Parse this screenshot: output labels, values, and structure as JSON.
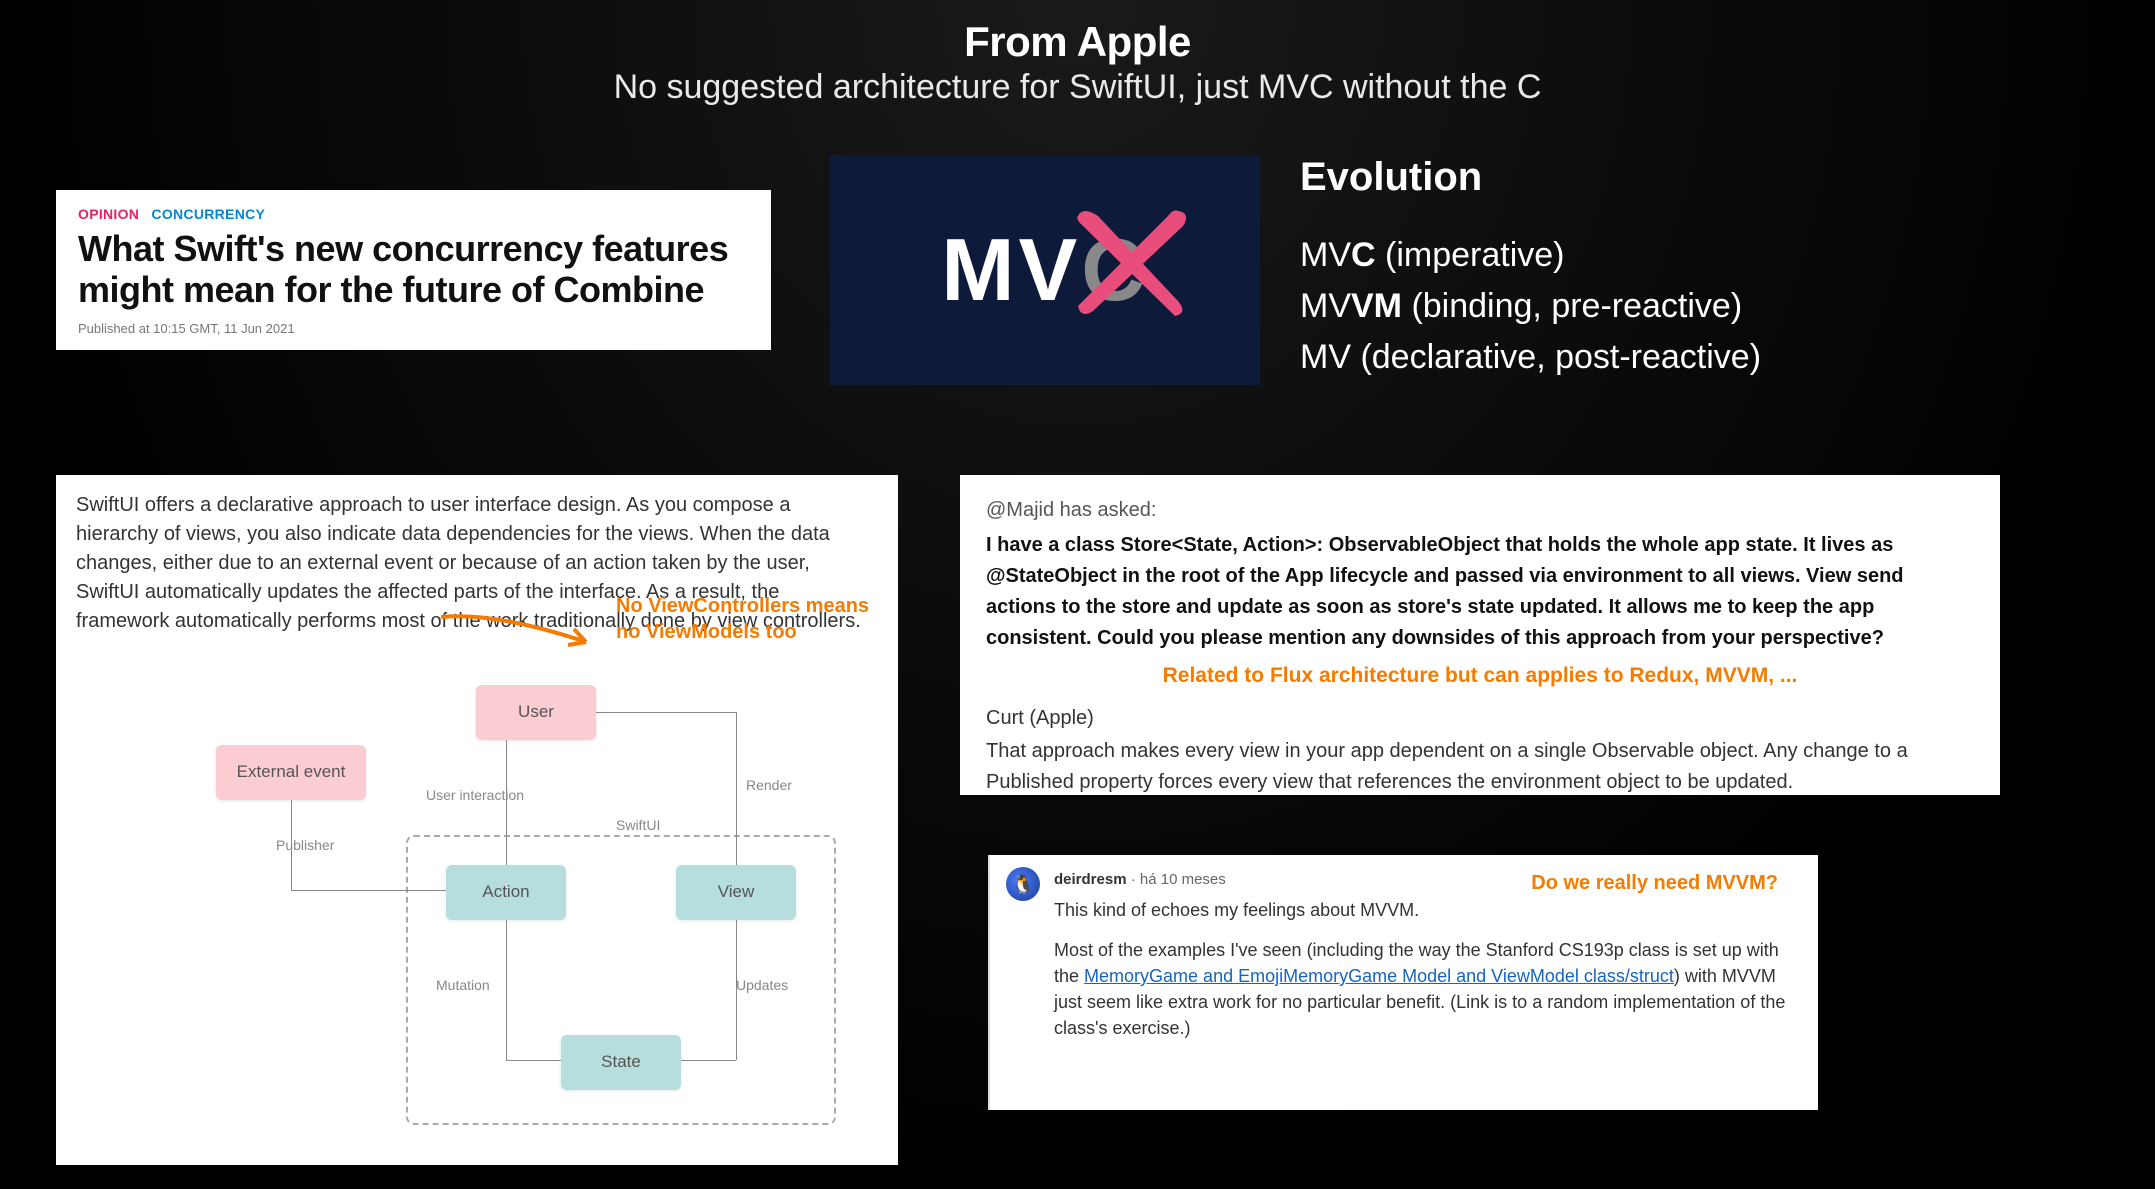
{
  "header": {
    "title": "From Apple",
    "subtitle": "No suggested architecture for SwiftUI, just MVC without the C"
  },
  "article": {
    "tag_opinion": "OPINION",
    "tag_concurrency": "CONCURRENCY",
    "title": "What Swift's new concurrency features might mean for the future of Combine",
    "published": "Published at 10:15 GMT, 11 Jun 2021"
  },
  "mvx": {
    "prefix": "MV",
    "crossed": "C"
  },
  "evolution": {
    "title": "Evolution",
    "line1_prefix": "MV",
    "line1_bold": "C",
    "line1_desc": " (imperative)",
    "line2_prefix": "MV",
    "line2_bold": "VM",
    "line2_desc": " (binding, pre-reactive)",
    "line3_prefix": "MV",
    "line3_bold": "",
    "line3_desc": " (declarative, post-reactive)"
  },
  "swiftui": {
    "para": "SwiftUI offers a declarative approach to user interface design. As you compose a hierarchy of views, you also indicate data dependencies for the views. When the data changes, either due to an external event or because of an action taken by the user, SwiftUI automatically updates the affected parts of the interface. As a result, the framework automatically performs most of the work traditionally done by view controllers.",
    "annotation": "No ViewControllers means no ViewModels too",
    "diagram": {
      "external_event": "External event",
      "user": "User",
      "action": "Action",
      "view": "View",
      "state": "State",
      "swiftui_label": "SwiftUI",
      "publisher": "Publisher",
      "user_interaction": "User interaction",
      "render": "Render",
      "mutation": "Mutation",
      "updates": "Updates"
    }
  },
  "curt": {
    "asker_label": "@Majid has asked:",
    "question": "I have a class Store<State, Action>: ObservableObject that holds the whole app state. It lives as @StateObject in the root of the App lifecycle and passed via environment to all views. View send actions to the store and update as soon as store's state updated. It allows me to keep the app consistent. Could you please mention any downsides of this approach from your perspective?",
    "flux_note": "Related to Flux architecture but can applies to Redux, MVVM, ...",
    "name": "Curt (Apple)",
    "answer": "That approach makes every view in your app dependent on a single Observable object. Any change to a Published property forces every view that references the environment object to be updated."
  },
  "forum": {
    "user": "deirdresm",
    "time": "há 10 meses",
    "tag": "Do we really need MVVM?",
    "p1": "This kind of echoes my feelings about MVVM.",
    "p2a": "Most of the examples I've seen (including the way the Stanford CS193p class is set up with the ",
    "link": "MemoryGame and EmojiMemoryGame Model and ViewModel class/struct",
    "p2b": ") with MVVM just seem like extra work for no particular benefit. (Link is to a random implementation of the class's exercise.)"
  }
}
